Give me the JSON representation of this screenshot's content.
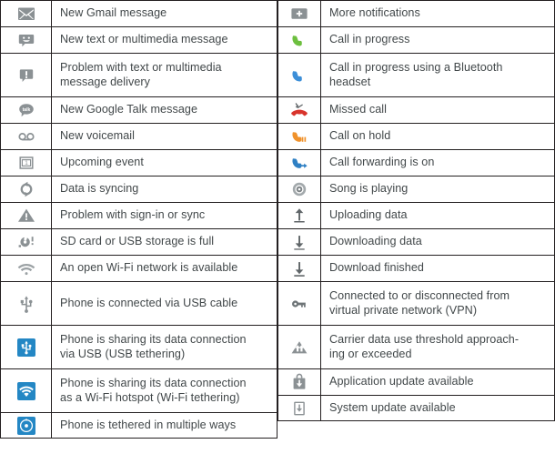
{
  "colors": {
    "grid": "#231f20",
    "text": "#414749",
    "icon_gray": "#848a8d",
    "icon_gray_dark": "#6e7477",
    "tile_blue": "#2487c4",
    "call_green": "#6dbf3f",
    "call_blue": "#3d8fd8",
    "call_red": "#d8342c",
    "call_orange": "#f0922c",
    "call_fwd_blue": "#2f80c4",
    "page_bg": "#ffffff"
  },
  "table": {
    "left_column": [
      {
        "icon": "gmail-envelope-icon",
        "label": "New Gmail message",
        "lines": [
          "New Gmail message"
        ]
      },
      {
        "icon": "sms-smiley-bubble-icon",
        "label": "New text or multimedia message",
        "lines": [
          "New text or multimedia message"
        ]
      },
      {
        "icon": "mms-error-bubble-icon",
        "label": "Problem with text or multimedia message delivery",
        "lines": [
          "Problem with text or multimedia",
          "message delivery"
        ]
      },
      {
        "icon": "google-talk-icon",
        "label": "New Google Talk message",
        "lines": [
          "New Google Talk message"
        ]
      },
      {
        "icon": "voicemail-icon",
        "label": "New voicemail",
        "lines": [
          "New voicemail"
        ]
      },
      {
        "icon": "calendar-event-icon",
        "label": "Upcoming event",
        "lines": [
          "Upcoming event"
        ]
      },
      {
        "icon": "sync-icon",
        "label": "Data is syncing",
        "lines": [
          "Data is syncing"
        ]
      },
      {
        "icon": "sync-problem-warning-icon",
        "label": "Problem with sign-in or sync",
        "lines": [
          "Problem with sign-in or sync"
        ]
      },
      {
        "icon": "sd-card-full-icon",
        "label": "SD card or USB storage is full",
        "lines": [
          "SD card or USB storage is full"
        ]
      },
      {
        "icon": "open-wifi-network-icon",
        "label": "An open Wi-Fi network is available",
        "lines": [
          "An open Wi-Fi network is available"
        ]
      },
      {
        "icon": "usb-cable-icon",
        "label": "Phone is connected via USB cable",
        "lines": [
          "Phone is connected via USB cable"
        ]
      },
      {
        "icon": "usb-tethering-icon",
        "label": "Phone is sharing its data connection via USB (USB tethering)",
        "lines": [
          "Phone is sharing its data connection",
          "via USB (USB tethering)"
        ]
      },
      {
        "icon": "wifi-hotspot-icon",
        "label": "Phone is sharing its data connection as a Wi-Fi hotspot (Wi-Fi tethering)",
        "lines": [
          "Phone is sharing its data connection",
          "as a Wi-Fi hotspot (Wi-Fi tethering)"
        ]
      },
      {
        "icon": "multiple-tethering-icon",
        "label": "Phone is tethered in multiple ways",
        "lines": [
          "Phone is tethered in multiple ways"
        ]
      }
    ],
    "right_column": [
      {
        "icon": "more-notifications-icon",
        "label": "More notifications",
        "lines": [
          "More notifications"
        ]
      },
      {
        "icon": "call-in-progress-icon",
        "label": "Call in progress",
        "lines": [
          "Call in progress"
        ]
      },
      {
        "icon": "call-bluetooth-icon",
        "label": "Call in progress using a Bluetooth headset",
        "lines": [
          "Call in progress using a Bluetooth",
          "headset"
        ]
      },
      {
        "icon": "missed-call-icon",
        "label": "Missed call",
        "lines": [
          "Missed call"
        ]
      },
      {
        "icon": "call-on-hold-icon",
        "label": "Call on hold",
        "lines": [
          "Call on hold"
        ]
      },
      {
        "icon": "call-forwarding-icon",
        "label": "Call forwarding is on",
        "lines": [
          "Call forwarding is on"
        ]
      },
      {
        "icon": "song-playing-icon",
        "label": "Song is playing",
        "lines": [
          "Song is playing"
        ]
      },
      {
        "icon": "uploading-data-icon",
        "label": "Uploading data",
        "lines": [
          "Uploading data"
        ]
      },
      {
        "icon": "downloading-data-icon",
        "label": "Downloading data",
        "lines": [
          "Downloading data"
        ]
      },
      {
        "icon": "download-finished-icon",
        "label": "Download finished",
        "lines": [
          "Download finished"
        ]
      },
      {
        "icon": "vpn-key-icon",
        "label": "Connected to or disconnected from virtual private network (VPN)",
        "lines": [
          "Connected to or disconnected from",
          "virtual private network (VPN)"
        ]
      },
      {
        "icon": "carrier-data-warning-icon",
        "label": "Carrier data use threshold approaching or exceeded",
        "lines": [
          "Carrier data use threshold approach-",
          "ing or exceeded"
        ]
      },
      {
        "icon": "app-update-icon",
        "label": "Application update available",
        "lines": [
          "Application update available"
        ]
      },
      {
        "icon": "system-update-icon",
        "label": "System update available",
        "lines": [
          "System update available"
        ]
      }
    ]
  }
}
